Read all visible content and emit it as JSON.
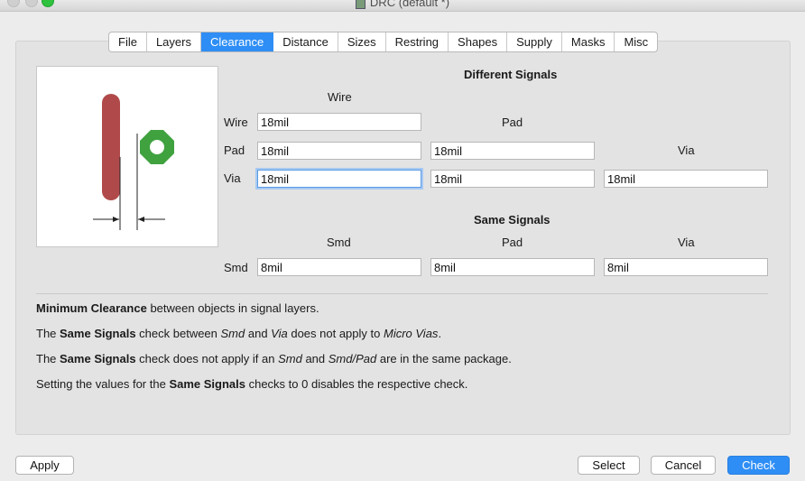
{
  "window": {
    "title": "DRC (default *)"
  },
  "tabs": [
    "File",
    "Layers",
    "Clearance",
    "Distance",
    "Sizes",
    "Restring",
    "Shapes",
    "Supply",
    "Masks",
    "Misc"
  ],
  "active_tab": "Clearance",
  "different_signals": {
    "heading": "Different Signals",
    "col_wire": "Wire",
    "col_pad": "Pad",
    "col_via": "Via",
    "row_wire": "Wire",
    "row_pad": "Pad",
    "row_via": "Via",
    "wire_wire": "18mil",
    "pad_wire": "18mil",
    "pad_pad": "18mil",
    "via_wire": "18mil",
    "via_pad": "18mil",
    "via_via": "18mil"
  },
  "same_signals": {
    "heading": "Same Signals",
    "col_smd": "Smd",
    "col_pad": "Pad",
    "col_via": "Via",
    "row_smd": "Smd",
    "smd_smd": "8mil",
    "smd_pad": "8mil",
    "smd_via": "8mil"
  },
  "description": {
    "line1_bold": "Minimum Clearance",
    "line1_rest": " between objects in signal layers.",
    "line2_a": "The ",
    "line2_bold": "Same Signals",
    "line2_b": " check between ",
    "line2_i1": "Smd",
    "line2_c": " and ",
    "line2_i2": "Via",
    "line2_d": " does not apply to ",
    "line2_i3": "Micro Vias",
    "line2_e": ".",
    "line3_a": "The ",
    "line3_bold": "Same Signals",
    "line3_b": " check does not apply if an ",
    "line3_i1": "Smd",
    "line3_c": " and ",
    "line3_i2": "Smd/Pad",
    "line3_d": " are in the same package.",
    "line4_a": "Setting the values for the ",
    "line4_bold": "Same Signals",
    "line4_b": " checks to 0 disables the respective check."
  },
  "buttons": {
    "apply": "Apply",
    "select": "Select",
    "cancel": "Cancel",
    "check": "Check"
  },
  "colors": {
    "accent": "#2e8ef5",
    "wire": "#b04a4a",
    "via": "#3fa23f"
  }
}
